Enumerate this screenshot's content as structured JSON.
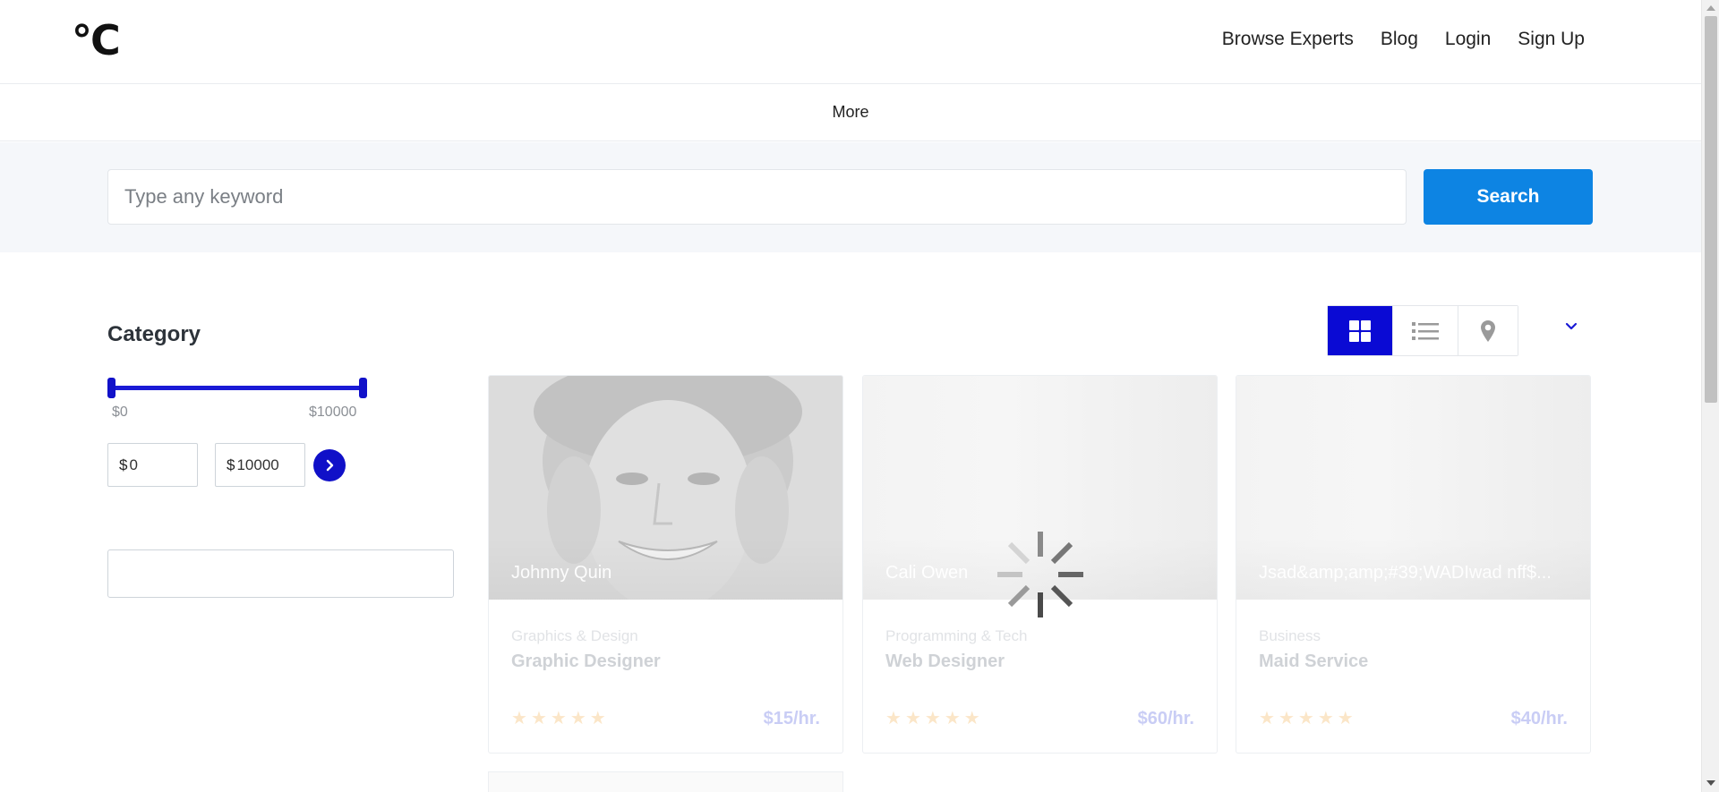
{
  "header": {
    "logo": "°C",
    "nav": [
      "Browse Experts",
      "Blog",
      "Login",
      "Sign Up"
    ]
  },
  "subbar": {
    "label": "More"
  },
  "search": {
    "placeholder": "Type any keyword",
    "button": "Search"
  },
  "sidebar": {
    "title": "Category",
    "price_range": {
      "min_label": "$0",
      "max_label": "$10000",
      "min_value": "0",
      "max_value": "10000",
      "currency": "$"
    }
  },
  "view": {
    "modes": [
      "grid-icon",
      "list-icon",
      "map-pin-icon"
    ],
    "active": "grid-icon"
  },
  "cards": [
    {
      "name": "Johnny Quin",
      "category": "Graphics & Design",
      "title": "Graphic Designer",
      "rate": "$15/hr.",
      "stars": 5
    },
    {
      "name": "Cali Owen",
      "category": "Programming & Tech",
      "title": "Web Designer",
      "rate": "$60/hr.",
      "stars": 5
    },
    {
      "name": "Jsad&amp;amp;#39;WADIwad nff$...",
      "category": "Business",
      "title": "Maid Service",
      "rate": "$40/hr.",
      "stars": 5
    }
  ],
  "colors": {
    "accent": "#0a0ad4",
    "search_button": "#0d84e3"
  }
}
